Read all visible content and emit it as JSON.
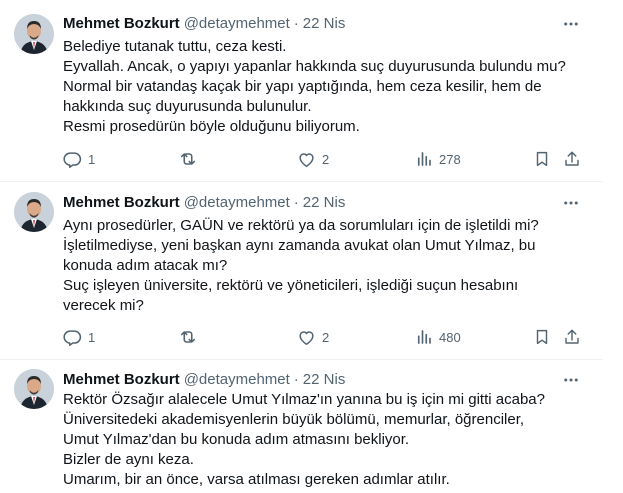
{
  "tweets": [
    {
      "author": "Mehmet Bozkurt",
      "handle": "@detaymehmet",
      "separator": "·",
      "date": "22 Nis",
      "lines": [
        "Belediye tutanak tuttu, ceza kesti.",
        "Eyvallah. Ancak, o yapıyı yapanlar hakkında suç duyurusunda bulundu mu?",
        "Normal bir vatandaş kaçak bir yapı yaptığında, hem ceza kesilir, hem de",
        "hakkında suç duyurusunda bulunulur.",
        "Resmi prosedürün böyle olduğunu biliyorum."
      ],
      "replies": "1",
      "retweets": "",
      "likes": "2",
      "views": "278"
    },
    {
      "author": "Mehmet Bozkurt",
      "handle": "@detaymehmet",
      "separator": "·",
      "date": "22 Nis",
      "lines": [
        "Aynı prosedürler, GAÜN ve rektörü ya da sorumluları için de işletildi mi?",
        "İşletilmediyse, yeni başkan aynı zamanda avukat olan Umut Yılmaz, bu",
        "konuda adım atacak mı?",
        "Suç işleyen üniversite, rektörü ve yöneticileri, işlediği suçun hesabını",
        "verecek mi?"
      ],
      "replies": "1",
      "retweets": "",
      "likes": "2",
      "views": "480"
    },
    {
      "author": "Mehmet Bozkurt",
      "handle": "@detaymehmet",
      "separator": "·",
      "date": "22 Nis",
      "lines": [
        "Rektör Özsağır alalecele Umut Yılmaz'ın yanına bu iş için mi gitti acaba?",
        "Üniversitedeki akademisyenlerin büyük bölümü, memurlar, öğrenciler,",
        "Umut Yılmaz'dan bu konuda adım atmasını bekliyor.",
        "Bizler de aynı keza.",
        "Umarım, bir an önce, varsa atılması gereken adımlar atılır."
      ],
      "replies": "",
      "retweets": "",
      "likes": "",
      "views": ""
    }
  ],
  "icons": {
    "reply": "reply-icon",
    "retweet": "retweet-icon",
    "like": "heart-icon",
    "views": "views-icon",
    "bookmark": "bookmark-icon",
    "share": "share-icon",
    "more": "more-icon"
  },
  "colors": {
    "text": "#0f1419",
    "secondary": "#536471",
    "separator": "#eff3f4"
  }
}
